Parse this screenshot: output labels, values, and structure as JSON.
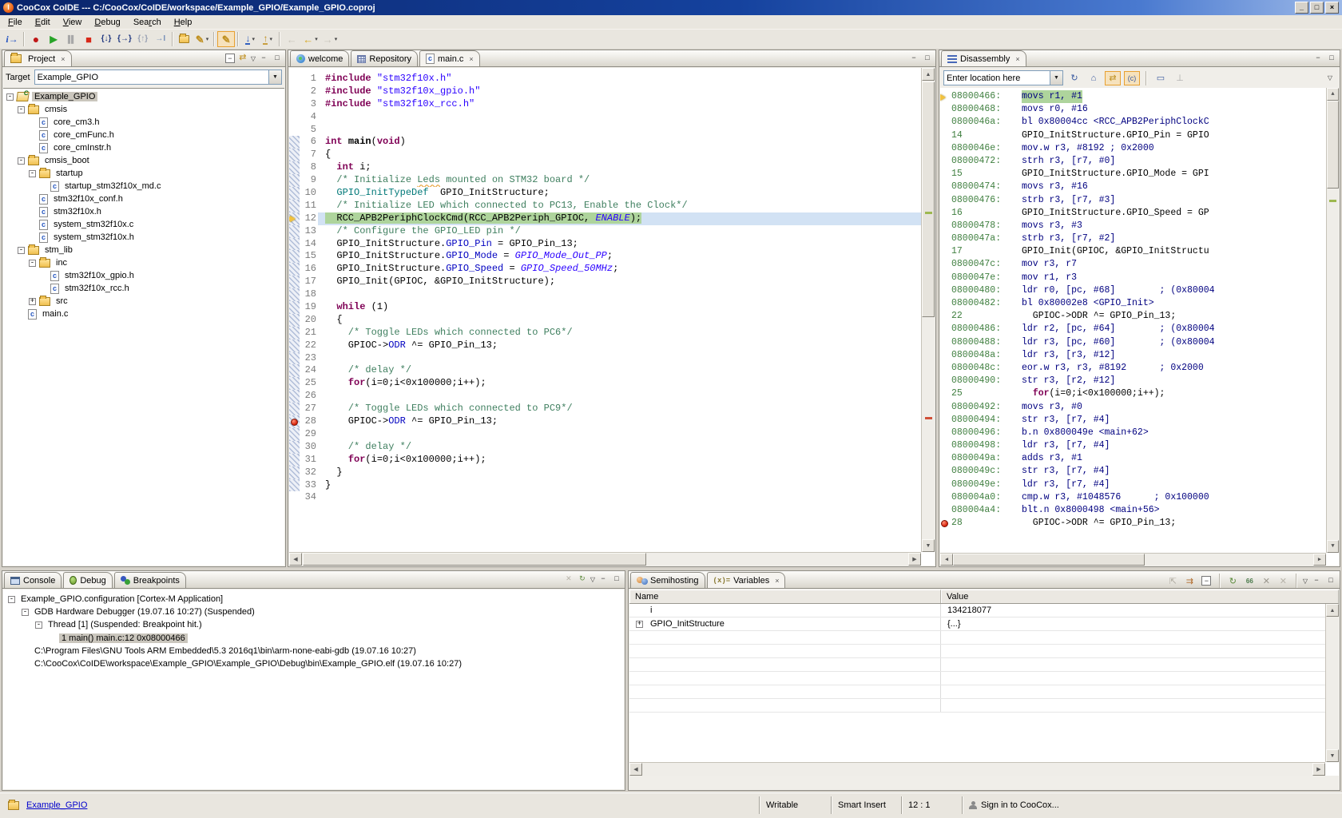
{
  "window": {
    "title": "CooCox CoIDE --- C:/CooCox/CoIDE/workspace/Example_GPIO/Example_GPIO.coproj"
  },
  "menu": [
    {
      "label": "File",
      "m": 0
    },
    {
      "label": "Edit",
      "m": 0
    },
    {
      "label": "View",
      "m": 0
    },
    {
      "label": "Debug",
      "m": 0
    },
    {
      "label": "Search",
      "m": 3
    },
    {
      "label": "Help",
      "m": 0
    }
  ],
  "toolbar": {
    "groups": [
      [
        {
          "n": "debug-instruction-pointer-button",
          "k": "info",
          "g": "i→"
        }
      ],
      [
        {
          "n": "reset-button",
          "k": "reset",
          "g": "●"
        },
        {
          "n": "start-debug-button",
          "k": "run",
          "g": "▶"
        },
        {
          "n": "pause-button",
          "k": "pause",
          "g": "▐▌"
        },
        {
          "n": "stop-debug-button",
          "k": "stop",
          "g": "■"
        },
        {
          "n": "step-into-button",
          "k": "stepin",
          "g": "{↓}"
        },
        {
          "n": "step-over-button",
          "k": "stepover",
          "g": "{→}"
        },
        {
          "n": "step-out-button",
          "k": "stepout",
          "g": "{↑}"
        },
        {
          "n": "run-to-cursor-button",
          "k": "runto",
          "g": "→I"
        }
      ],
      [
        {
          "n": "open-project-button",
          "k": "folder",
          "g": ""
        },
        {
          "n": "configuration-button",
          "k": "wand",
          "g": "✎",
          "caret": true
        }
      ],
      [
        {
          "n": "highlight-button",
          "k": "brush",
          "g": "✎",
          "pressed": true
        }
      ],
      [
        {
          "n": "download-to-flash-button",
          "k": "download",
          "g": "↓",
          "caret": true
        },
        {
          "n": "program-verify-button",
          "k": "verify",
          "g": "↑",
          "caret": true
        }
      ],
      [
        {
          "n": "back-disabled-button",
          "k": "backdis",
          "g": "←"
        },
        {
          "n": "back-history-button",
          "k": "back",
          "g": "←",
          "caret": true
        },
        {
          "n": "forward-disabled-button",
          "k": "fwddis",
          "g": "→",
          "caret": true
        }
      ]
    ]
  },
  "project": {
    "tab_label": "Project",
    "target_label": "Target",
    "target_value": "Example_GPIO",
    "tree": [
      {
        "d": 0,
        "i": "proj",
        "e": "-",
        "t": "Example_GPIO",
        "sel": true
      },
      {
        "d": 1,
        "i": "fold",
        "e": "-",
        "t": "cmsis"
      },
      {
        "d": 2,
        "i": "cfile",
        "t": "core_cm3.h"
      },
      {
        "d": 2,
        "i": "cfile",
        "t": "core_cmFunc.h"
      },
      {
        "d": 2,
        "i": "cfile",
        "t": "core_cmInstr.h"
      },
      {
        "d": 1,
        "i": "fold",
        "e": "-",
        "t": "cmsis_boot"
      },
      {
        "d": 2,
        "i": "fold",
        "e": "-",
        "t": "startup"
      },
      {
        "d": 3,
        "i": "cfile",
        "t": "startup_stm32f10x_md.c"
      },
      {
        "d": 2,
        "i": "cfile",
        "t": "stm32f10x_conf.h"
      },
      {
        "d": 2,
        "i": "cfile",
        "t": "stm32f10x.h"
      },
      {
        "d": 2,
        "i": "cfile",
        "t": "system_stm32f10x.c"
      },
      {
        "d": 2,
        "i": "cfile",
        "t": "system_stm32f10x.h"
      },
      {
        "d": 1,
        "i": "fold",
        "e": "-",
        "t": "stm_lib"
      },
      {
        "d": 2,
        "i": "fold",
        "e": "-",
        "t": "inc"
      },
      {
        "d": 3,
        "i": "cfile",
        "t": "stm32f10x_gpio.h"
      },
      {
        "d": 3,
        "i": "cfile",
        "t": "stm32f10x_rcc.h"
      },
      {
        "d": 2,
        "i": "fold",
        "e": "+",
        "t": "src"
      },
      {
        "d": 1,
        "i": "cfile",
        "t": "main.c"
      }
    ]
  },
  "editor": {
    "tabs": [
      {
        "label": "welcome",
        "icon": "welcome",
        "active": false
      },
      {
        "label": "Repository",
        "icon": "repo",
        "active": false
      },
      {
        "label": "main.c",
        "icon": "cfile",
        "active": true,
        "closable": true
      }
    ],
    "lines": [
      {
        "n": 1,
        "segs": [
          [
            "kw",
            "#include"
          ],
          [
            "pl",
            " "
          ],
          [
            "str",
            "\"stm32f10x.h\""
          ]
        ]
      },
      {
        "n": 2,
        "segs": [
          [
            "kw",
            "#include"
          ],
          [
            "pl",
            " "
          ],
          [
            "str",
            "\"stm32f10x_gpio.h\""
          ]
        ]
      },
      {
        "n": 3,
        "segs": [
          [
            "kw",
            "#include"
          ],
          [
            "pl",
            " "
          ],
          [
            "str",
            "\"stm32f10x_rcc.h\""
          ]
        ]
      },
      {
        "n": 4,
        "segs": []
      },
      {
        "n": 5,
        "segs": []
      },
      {
        "n": 6,
        "segs": [
          [
            "kw",
            "int"
          ],
          [
            "pl",
            " "
          ],
          [
            "fn",
            "main"
          ],
          [
            "pl",
            "("
          ],
          [
            "kw",
            "void"
          ],
          [
            "pl",
            ")"
          ]
        ]
      },
      {
        "n": 7,
        "segs": [
          [
            "pl",
            "{"
          ]
        ]
      },
      {
        "n": 8,
        "segs": [
          [
            "pl",
            "  "
          ],
          [
            "kw",
            "int"
          ],
          [
            "pl",
            " i;"
          ]
        ]
      },
      {
        "n": 9,
        "segs": [
          [
            "com",
            "  /* Initialize "
          ],
          [
            "comsp",
            "Leds"
          ],
          [
            "com",
            " mounted on STM32 board */"
          ]
        ]
      },
      {
        "n": 10,
        "segs": [
          [
            "pl",
            "  "
          ],
          [
            "typ",
            "GPIO_InitTypeDef"
          ],
          [
            "pl",
            "  GPIO_InitStructure;"
          ]
        ]
      },
      {
        "n": 11,
        "segs": [
          [
            "com",
            "  /* Initialize LED which connected to PC13, Enable the Clock*/"
          ]
        ]
      },
      {
        "n": 12,
        "cur": true,
        "segs": [
          [
            "pl",
            "  RCC_APB2PeriphClockCmd(RCC_APB2Periph_GPIOC, "
          ],
          [
            "enu",
            "ENABLE"
          ],
          [
            "pl",
            ");"
          ]
        ]
      },
      {
        "n": 13,
        "segs": [
          [
            "com",
            "  /* Configure the GPIO_LED pin */"
          ]
        ]
      },
      {
        "n": 14,
        "segs": [
          [
            "pl",
            "  GPIO_InitStructure."
          ],
          [
            "mem",
            "GPIO_Pin"
          ],
          [
            "pl",
            " = GPIO_Pin_13;"
          ]
        ]
      },
      {
        "n": 15,
        "segs": [
          [
            "pl",
            "  GPIO_InitStructure."
          ],
          [
            "mem",
            "GPIO_Mode"
          ],
          [
            "pl",
            " = "
          ],
          [
            "enu",
            "GPIO_Mode_Out_PP"
          ],
          [
            "pl",
            ";"
          ]
        ]
      },
      {
        "n": 16,
        "segs": [
          [
            "pl",
            "  GPIO_InitStructure."
          ],
          [
            "mem",
            "GPIO_Speed"
          ],
          [
            "pl",
            " = "
          ],
          [
            "enu",
            "GPIO_Speed_50MHz"
          ],
          [
            "pl",
            ";"
          ]
        ]
      },
      {
        "n": 17,
        "segs": [
          [
            "pl",
            "  GPIO_Init(GPIOC, &GPIO_InitStructure);"
          ]
        ]
      },
      {
        "n": 18,
        "segs": []
      },
      {
        "n": 19,
        "segs": [
          [
            "pl",
            "  "
          ],
          [
            "kw",
            "while"
          ],
          [
            "pl",
            " (1)"
          ]
        ]
      },
      {
        "n": 20,
        "segs": [
          [
            "pl",
            "  {"
          ]
        ]
      },
      {
        "n": 21,
        "segs": [
          [
            "com",
            "    /* Toggle LEDs which connected to PC6*/"
          ]
        ]
      },
      {
        "n": 22,
        "segs": [
          [
            "pl",
            "    GPIOC->"
          ],
          [
            "mem",
            "ODR"
          ],
          [
            "pl",
            " ^= GPIO_Pin_13;"
          ]
        ]
      },
      {
        "n": 23,
        "segs": []
      },
      {
        "n": 24,
        "segs": [
          [
            "com",
            "    /* delay */"
          ]
        ]
      },
      {
        "n": 25,
        "segs": [
          [
            "pl",
            "    "
          ],
          [
            "kw",
            "for"
          ],
          [
            "pl",
            "(i=0;i<0x100000;i++);"
          ]
        ]
      },
      {
        "n": 26,
        "segs": []
      },
      {
        "n": 27,
        "segs": [
          [
            "com",
            "    /* Toggle LEDs which connected to PC9*/"
          ]
        ]
      },
      {
        "n": 28,
        "bp": true,
        "segs": [
          [
            "pl",
            "    GPIOC->"
          ],
          [
            "mem",
            "ODR"
          ],
          [
            "pl",
            " ^= GPIO_Pin_13;"
          ]
        ]
      },
      {
        "n": 29,
        "segs": []
      },
      {
        "n": 30,
        "segs": [
          [
            "com",
            "    /* delay */"
          ]
        ]
      },
      {
        "n": 31,
        "segs": [
          [
            "pl",
            "    "
          ],
          [
            "kw",
            "for"
          ],
          [
            "pl",
            "(i=0;i<0x100000;i++);"
          ]
        ]
      },
      {
        "n": 32,
        "segs": [
          [
            "pl",
            "  }"
          ]
        ]
      },
      {
        "n": 33,
        "segs": [
          [
            "pl",
            "}"
          ]
        ]
      },
      {
        "n": 34,
        "segs": []
      }
    ]
  },
  "disasm": {
    "tab_label": "Disassembly",
    "location_text": "Enter location here",
    "rows": [
      {
        "k": "a",
        "l": "08000466:",
        "t": "movs r1, #1",
        "cur": true
      },
      {
        "k": "a",
        "l": "08000468:",
        "t": "movs r0, #16"
      },
      {
        "k": "a",
        "l": "0800046a:",
        "t": "bl 0x80004cc <RCC_APB2PeriphClockC"
      },
      {
        "k": "s",
        "l": "14",
        "t": "GPIO_InitStructure.GPIO_Pin = GPIO"
      },
      {
        "k": "a",
        "l": "0800046e:",
        "t": "mov.w r3, #8192 ; 0x2000"
      },
      {
        "k": "a",
        "l": "08000472:",
        "t": "strh r3, [r7, #0]"
      },
      {
        "k": "s",
        "l": "15",
        "t": "GPIO_InitStructure.GPIO_Mode = GPI"
      },
      {
        "k": "a",
        "l": "08000474:",
        "t": "movs r3, #16"
      },
      {
        "k": "a",
        "l": "08000476:",
        "t": "strb r3, [r7, #3]"
      },
      {
        "k": "s",
        "l": "16",
        "t": "GPIO_InitStructure.GPIO_Speed = GP"
      },
      {
        "k": "a",
        "l": "08000478:",
        "t": "movs r3, #3"
      },
      {
        "k": "a",
        "l": "0800047a:",
        "t": "strb r3, [r7, #2]"
      },
      {
        "k": "s",
        "l": "17",
        "t": "GPIO_Init(GPIOC, &GPIO_InitStructu"
      },
      {
        "k": "a",
        "l": "0800047c:",
        "t": "mov r3, r7"
      },
      {
        "k": "a",
        "l": "0800047e:",
        "t": "mov r1, r3"
      },
      {
        "k": "a",
        "l": "08000480:",
        "t": "ldr r0, [pc, #68]        ; (0x80004"
      },
      {
        "k": "a",
        "l": "08000482:",
        "t": "bl 0x80002e8 <GPIO_Init>"
      },
      {
        "k": "s",
        "l": "22",
        "t": "  GPIOC->ODR ^= GPIO_Pin_13;"
      },
      {
        "k": "a",
        "l": "08000486:",
        "t": "ldr r2, [pc, #64]        ; (0x80004"
      },
      {
        "k": "a",
        "l": "08000488:",
        "t": "ldr r3, [pc, #60]        ; (0x80004"
      },
      {
        "k": "a",
        "l": "0800048a:",
        "t": "ldr r3, [r3, #12]"
      },
      {
        "k": "a",
        "l": "0800048c:",
        "t": "eor.w r3, r3, #8192      ; 0x2000"
      },
      {
        "k": "a",
        "l": "08000490:",
        "t": "str r3, [r2, #12]"
      },
      {
        "k": "s",
        "l": "25",
        "segs": [
          [
            "pl",
            "  "
          ],
          [
            "kw",
            "for"
          ],
          [
            "pl",
            "(i=0;i<0x100000;i++);"
          ]
        ]
      },
      {
        "k": "a",
        "l": "08000492:",
        "t": "movs r3, #0"
      },
      {
        "k": "a",
        "l": "08000494:",
        "t": "str r3, [r7, #4]"
      },
      {
        "k": "a",
        "l": "08000496:",
        "t": "b.n 0x800049e <main+62>"
      },
      {
        "k": "a",
        "l": "08000498:",
        "t": "ldr r3, [r7, #4]"
      },
      {
        "k": "a",
        "l": "0800049a:",
        "t": "adds r3, #1"
      },
      {
        "k": "a",
        "l": "0800049c:",
        "t": "str r3, [r7, #4]"
      },
      {
        "k": "a",
        "l": "0800049e:",
        "t": "ldr r3, [r7, #4]"
      },
      {
        "k": "a",
        "l": "080004a0:",
        "t": "cmp.w r3, #1048576      ; 0x100000"
      },
      {
        "k": "a",
        "l": "080004a4:",
        "t": "blt.n 0x8000498 <main+56>"
      },
      {
        "k": "s",
        "l": "28",
        "t": "  GPIOC->ODR ^= GPIO_Pin_13;",
        "bp": true
      }
    ]
  },
  "console": {
    "tabs": [
      {
        "label": "Console",
        "icon": "console",
        "active": false
      },
      {
        "label": "Debug",
        "icon": "bug",
        "active": true
      },
      {
        "label": "Breakpoints",
        "icon": "bps",
        "active": false
      }
    ],
    "tree": [
      {
        "d": 0,
        "e": "-",
        "t": "Example_GPIO.configuration [Cortex-M Application]"
      },
      {
        "d": 1,
        "e": "-",
        "t": "GDB Hardware Debugger (19.07.16 10:27) (Suspended)"
      },
      {
        "d": 2,
        "e": "-",
        "t": "Thread [1] (Suspended: Breakpoint hit.)"
      },
      {
        "d": 3,
        "t": "1 main() main.c:12 0x08000466",
        "sel": true
      },
      {
        "d": 1,
        "t": "C:\\Program Files\\GNU Tools ARM Embedded\\5.3 2016q1\\bin\\arm-none-eabi-gdb (19.07.16 10:27)"
      },
      {
        "d": 1,
        "t": "C:\\CooCox\\CoIDE\\workspace\\Example_GPIO\\Example_GPIO\\Debug\\bin\\Example_GPIO.elf (19.07.16 10:27)"
      }
    ]
  },
  "vars": {
    "tabs": [
      {
        "label": "Semihosting",
        "icon": "semi",
        "active": false
      },
      {
        "label": "Variables",
        "icon": "vars",
        "active": true,
        "closable": true
      }
    ],
    "columns": [
      "Name",
      "Value"
    ],
    "rows": [
      {
        "name": "i",
        "value": "134218077",
        "expandable": false
      },
      {
        "name": "GPIO_InitStructure",
        "value": "{...}",
        "expandable": true
      }
    ],
    "empty_rows": 6
  },
  "status": {
    "project": "Example_GPIO",
    "writable": "Writable",
    "insert_mode": "Smart Insert",
    "position": "12 : 1",
    "signin": "Sign in to CooCox..."
  },
  "colors": {
    "title_gradient_start": "#0a246a",
    "title_gradient_end": "#9db9e8",
    "exec_line_green": "#aed49c",
    "selected_line_blue": "#d2e2f4",
    "keyword": "#7f0055",
    "string": "#2a00ff",
    "comment": "#3f7f5f",
    "address_green": "#3f7f3f",
    "instruction_navy": "#000080",
    "breakpoint_red": "#d41800"
  }
}
